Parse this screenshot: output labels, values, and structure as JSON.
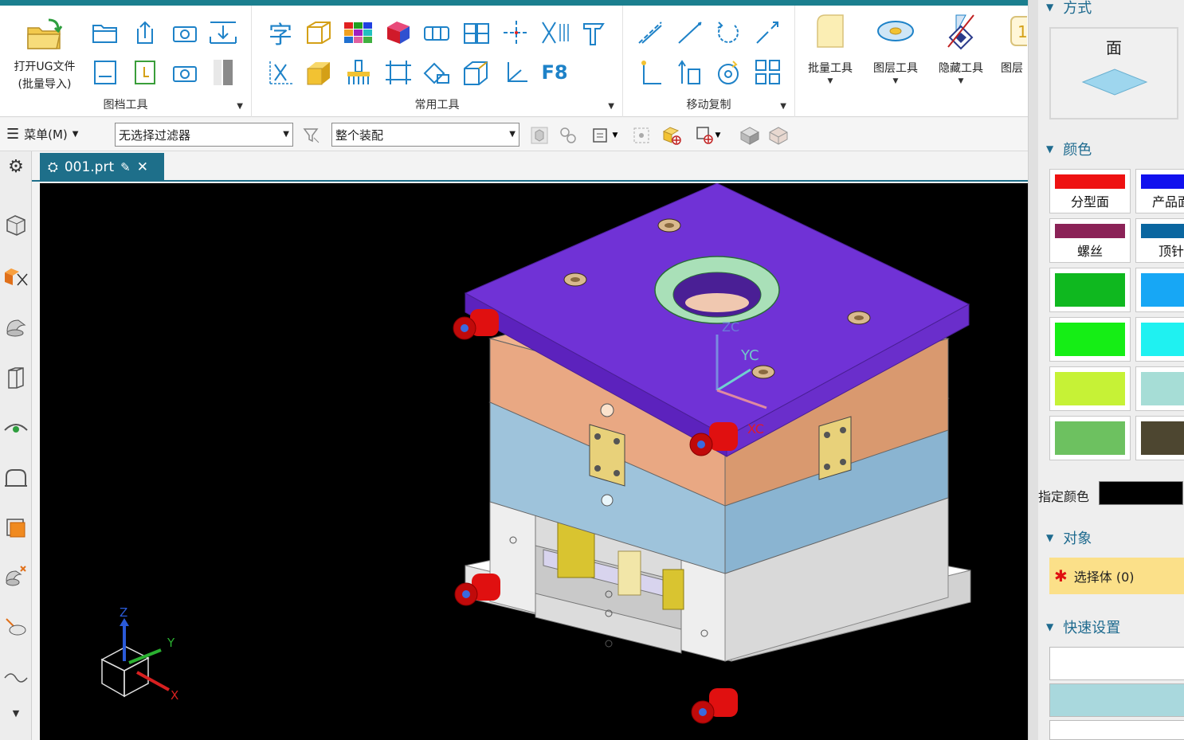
{
  "ribbon": {
    "file_group_label": "图档工具",
    "common_group_label": "常用工具",
    "move_group_label": "移动复制",
    "open_ug_label_line1": "打开UG文件",
    "open_ug_label_line2": "(批量导入)",
    "text_tool_glyph": "字",
    "f8_label": "F8",
    "batch_tools_label": "批量工具",
    "layer_tools_label": "图层工具",
    "hide_tools_label": "隐藏工具",
    "layer_cut_label": "图层"
  },
  "selection_bar": {
    "menu_label": "菜单(M)",
    "filter_value": "无选择过滤器",
    "scope_value": "整个装配"
  },
  "tabs": [
    {
      "label": "001.prt"
    }
  ],
  "viewport": {
    "triad_z": "Z",
    "triad_y": "Y",
    "triad_x": "X",
    "wcs_zc": "ZC",
    "wcs_yc": "YC",
    "wcs_xc": "XC"
  },
  "right_panel": {
    "mode_section": "方式",
    "mode_face_label": "面",
    "color_section": "颜色",
    "swatches": [
      {
        "label": "分型面",
        "color": "#ee1111"
      },
      {
        "label": "产品面",
        "color": "#1010ee"
      },
      {
        "label": "螺丝",
        "color": "#8b2257"
      },
      {
        "label": "顶针",
        "color": "#0a66a0"
      },
      {
        "label": "",
        "color": "#0fb81f"
      },
      {
        "label": "",
        "color": "#17a7f5"
      },
      {
        "label": "",
        "color": "#15ee15"
      },
      {
        "label": "",
        "color": "#1ff1f1"
      },
      {
        "label": "",
        "color": "#c6f236"
      },
      {
        "label": "",
        "color": "#a6ddd6"
      },
      {
        "label": "",
        "color": "#6dc160"
      },
      {
        "label": "",
        "color": "#4d4630"
      }
    ],
    "assign_color_label": "指定颜色",
    "assign_color_value": "#000000",
    "object_section": "对象",
    "select_body_label": "选择体 (0)",
    "quick_section": "快速设置"
  },
  "colors": {
    "accent": "#1e6f8a",
    "topline": "#1b7f8f",
    "viewport_bg": "#000000"
  }
}
